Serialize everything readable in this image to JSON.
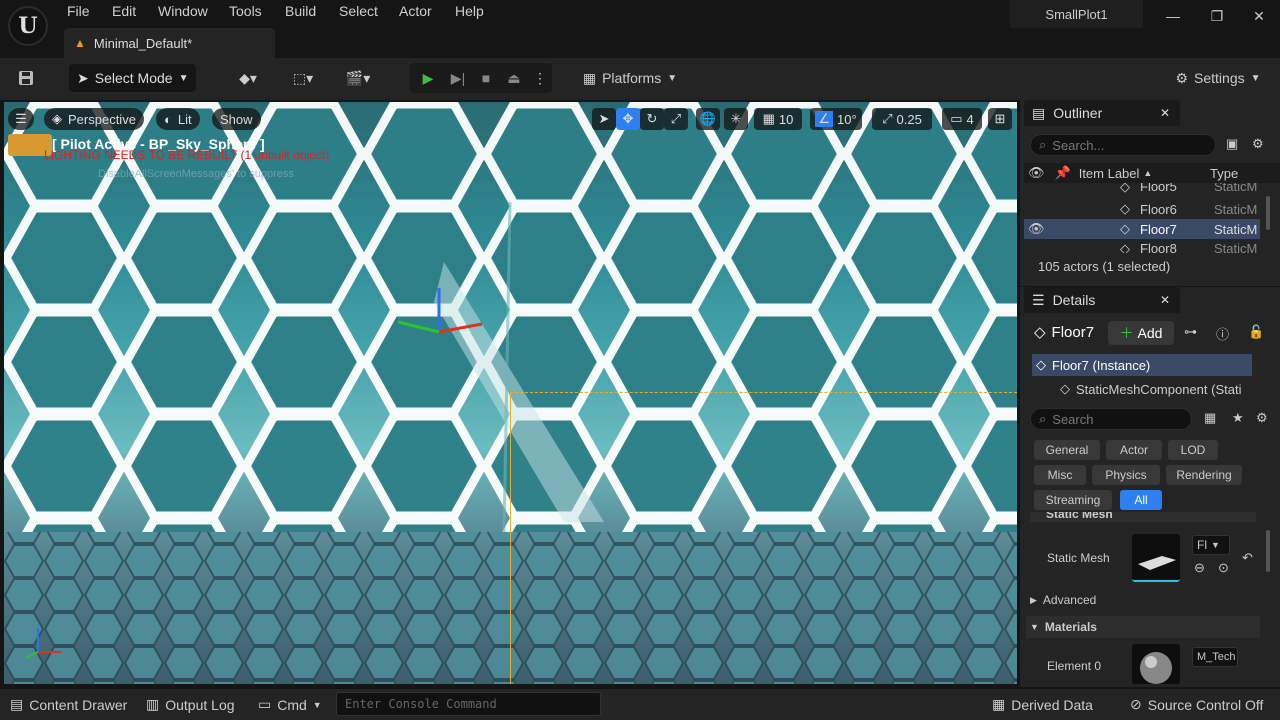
{
  "menu": [
    "File",
    "Edit",
    "Window",
    "Tools",
    "Build",
    "Select",
    "Actor",
    "Help"
  ],
  "project_tab": "Minimal_Default*",
  "project_name": "SmallPlot1",
  "toolbar": {
    "select_mode": "Select Mode",
    "platforms": "Platforms",
    "settings": "Settings"
  },
  "viewport": {
    "perspective": "Perspective",
    "lit": "Lit",
    "show": "Show",
    "grid_snap": "10",
    "rot_snap": "10°",
    "scale_snap": "0.25",
    "camera_speed": "4",
    "pilot": "[ Pilot Active - BP_Sky_Sphere ]",
    "lighting_warning": "LIGHTING NEEDS TO BE REBUILT (1 unbuilt object)",
    "disable_msg": "DisableAllScreenMessages' to suppress"
  },
  "outliner": {
    "title": "Outliner",
    "search_placeholder": "Search...",
    "col_label": "Item Label",
    "col_type": "Type",
    "rows": [
      {
        "label": "Floor5",
        "type": "StaticM"
      },
      {
        "label": "Floor6",
        "type": "StaticM"
      },
      {
        "label": "Floor7",
        "type": "StaticM"
      },
      {
        "label": "Floor8",
        "type": "StaticM"
      }
    ],
    "status": "105 actors (1 selected)"
  },
  "details": {
    "title": "Details",
    "object": "Floor7",
    "add": "Add",
    "instance": "Floor7 (Instance)",
    "component": "StaticMeshComponent (Stati",
    "search_placeholder": "Search",
    "chips": [
      "General",
      "Actor",
      "LOD",
      "Misc",
      "Physics",
      "Rendering",
      "Streaming",
      "All"
    ],
    "static_mesh_header": "Static Mesh",
    "static_mesh_label": "Static Mesh",
    "static_mesh_value": "Fl",
    "advanced": "Advanced",
    "materials": "Materials",
    "element0": "Element 0",
    "material_value": "M_Tech"
  },
  "bottombar": {
    "content_drawer": "Content Drawer",
    "output_log": "Output Log",
    "cmd": "Cmd",
    "console_placeholder": "Enter Console Command",
    "derived_data": "Derived Data",
    "source_control": "Source Control Off"
  },
  "colors": {
    "accent": "#2e7ff0",
    "warning": "#e02020",
    "selection": "#e0b030"
  }
}
